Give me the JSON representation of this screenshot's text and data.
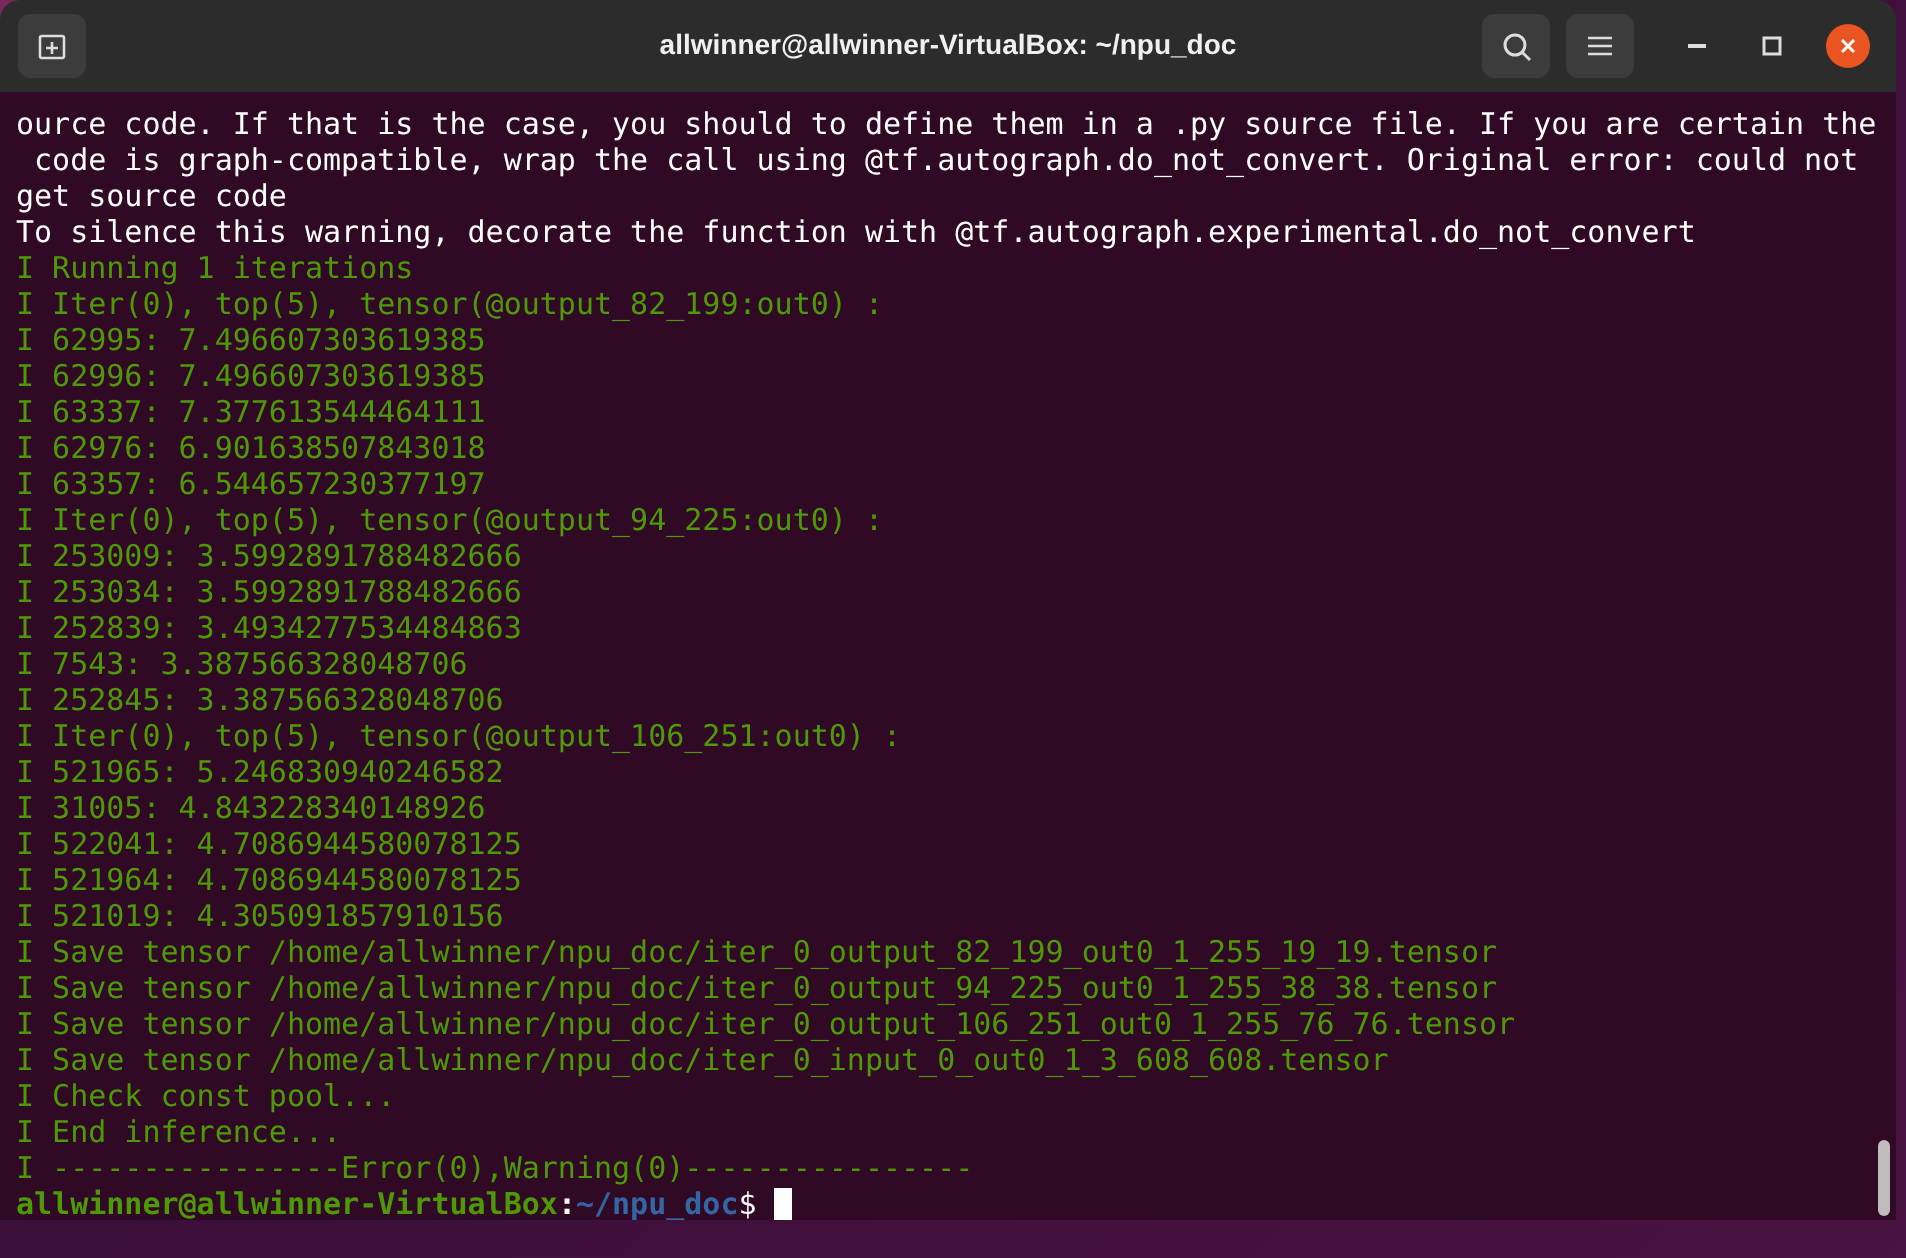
{
  "window": {
    "title": "allwinner@allwinner-VirtualBox: ~/npu_doc"
  },
  "terminal": {
    "lines": [
      {
        "kind": "plain",
        "text": "ource code. If that is the case, you should to define them in a .py source file. If you are certain the"
      },
      {
        "kind": "plain",
        "text": " code is graph-compatible, wrap the call using @tf.autograph.do_not_convert. Original error: could not"
      },
      {
        "kind": "plain",
        "text": "get source code"
      },
      {
        "kind": "plain",
        "text": "To silence this warning, decorate the function with @tf.autograph.experimental.do_not_convert"
      },
      {
        "kind": "info",
        "text": "I Running 1 iterations"
      },
      {
        "kind": "info",
        "text": "I Iter(0), top(5), tensor(@output_82_199:out0) :"
      },
      {
        "kind": "info",
        "text": "I 62995: 7.496607303619385"
      },
      {
        "kind": "info",
        "text": "I 62996: 7.496607303619385"
      },
      {
        "kind": "info",
        "text": "I 63337: 7.377613544464111"
      },
      {
        "kind": "info",
        "text": "I 62976: 6.901638507843018"
      },
      {
        "kind": "info",
        "text": "I 63357: 6.544657230377197"
      },
      {
        "kind": "info",
        "text": "I Iter(0), top(5), tensor(@output_94_225:out0) :"
      },
      {
        "kind": "info",
        "text": "I 253009: 3.5992891788482666"
      },
      {
        "kind": "info",
        "text": "I 253034: 3.5992891788482666"
      },
      {
        "kind": "info",
        "text": "I 252839: 3.4934277534484863"
      },
      {
        "kind": "info",
        "text": "I 7543: 3.387566328048706"
      },
      {
        "kind": "info",
        "text": "I 252845: 3.387566328048706"
      },
      {
        "kind": "info",
        "text": "I Iter(0), top(5), tensor(@output_106_251:out0) :"
      },
      {
        "kind": "info",
        "text": "I 521965: 5.246830940246582"
      },
      {
        "kind": "info",
        "text": "I 31005: 4.843228340148926"
      },
      {
        "kind": "info",
        "text": "I 522041: 4.7086944580078125"
      },
      {
        "kind": "info",
        "text": "I 521964: 4.7086944580078125"
      },
      {
        "kind": "info",
        "text": "I 521019: 4.305091857910156"
      },
      {
        "kind": "info",
        "text": "I Save tensor /home/allwinner/npu_doc/iter_0_output_82_199_out0_1_255_19_19.tensor"
      },
      {
        "kind": "info",
        "text": "I Save tensor /home/allwinner/npu_doc/iter_0_output_94_225_out0_1_255_38_38.tensor"
      },
      {
        "kind": "info",
        "text": "I Save tensor /home/allwinner/npu_doc/iter_0_output_106_251_out0_1_255_76_76.tensor"
      },
      {
        "kind": "info",
        "text": "I Save tensor /home/allwinner/npu_doc/iter_0_input_0_out0_1_3_608_608.tensor"
      },
      {
        "kind": "info",
        "text": "I Check const pool..."
      },
      {
        "kind": "info",
        "text": "I End inference..."
      },
      {
        "kind": "info",
        "text": "I ----------------Error(0),Warning(0)----------------"
      }
    ],
    "prompt": {
      "user_host": "allwinner@allwinner-VirtualBox",
      "separator": ":",
      "path": "~/npu_doc",
      "symbol": "$"
    }
  }
}
